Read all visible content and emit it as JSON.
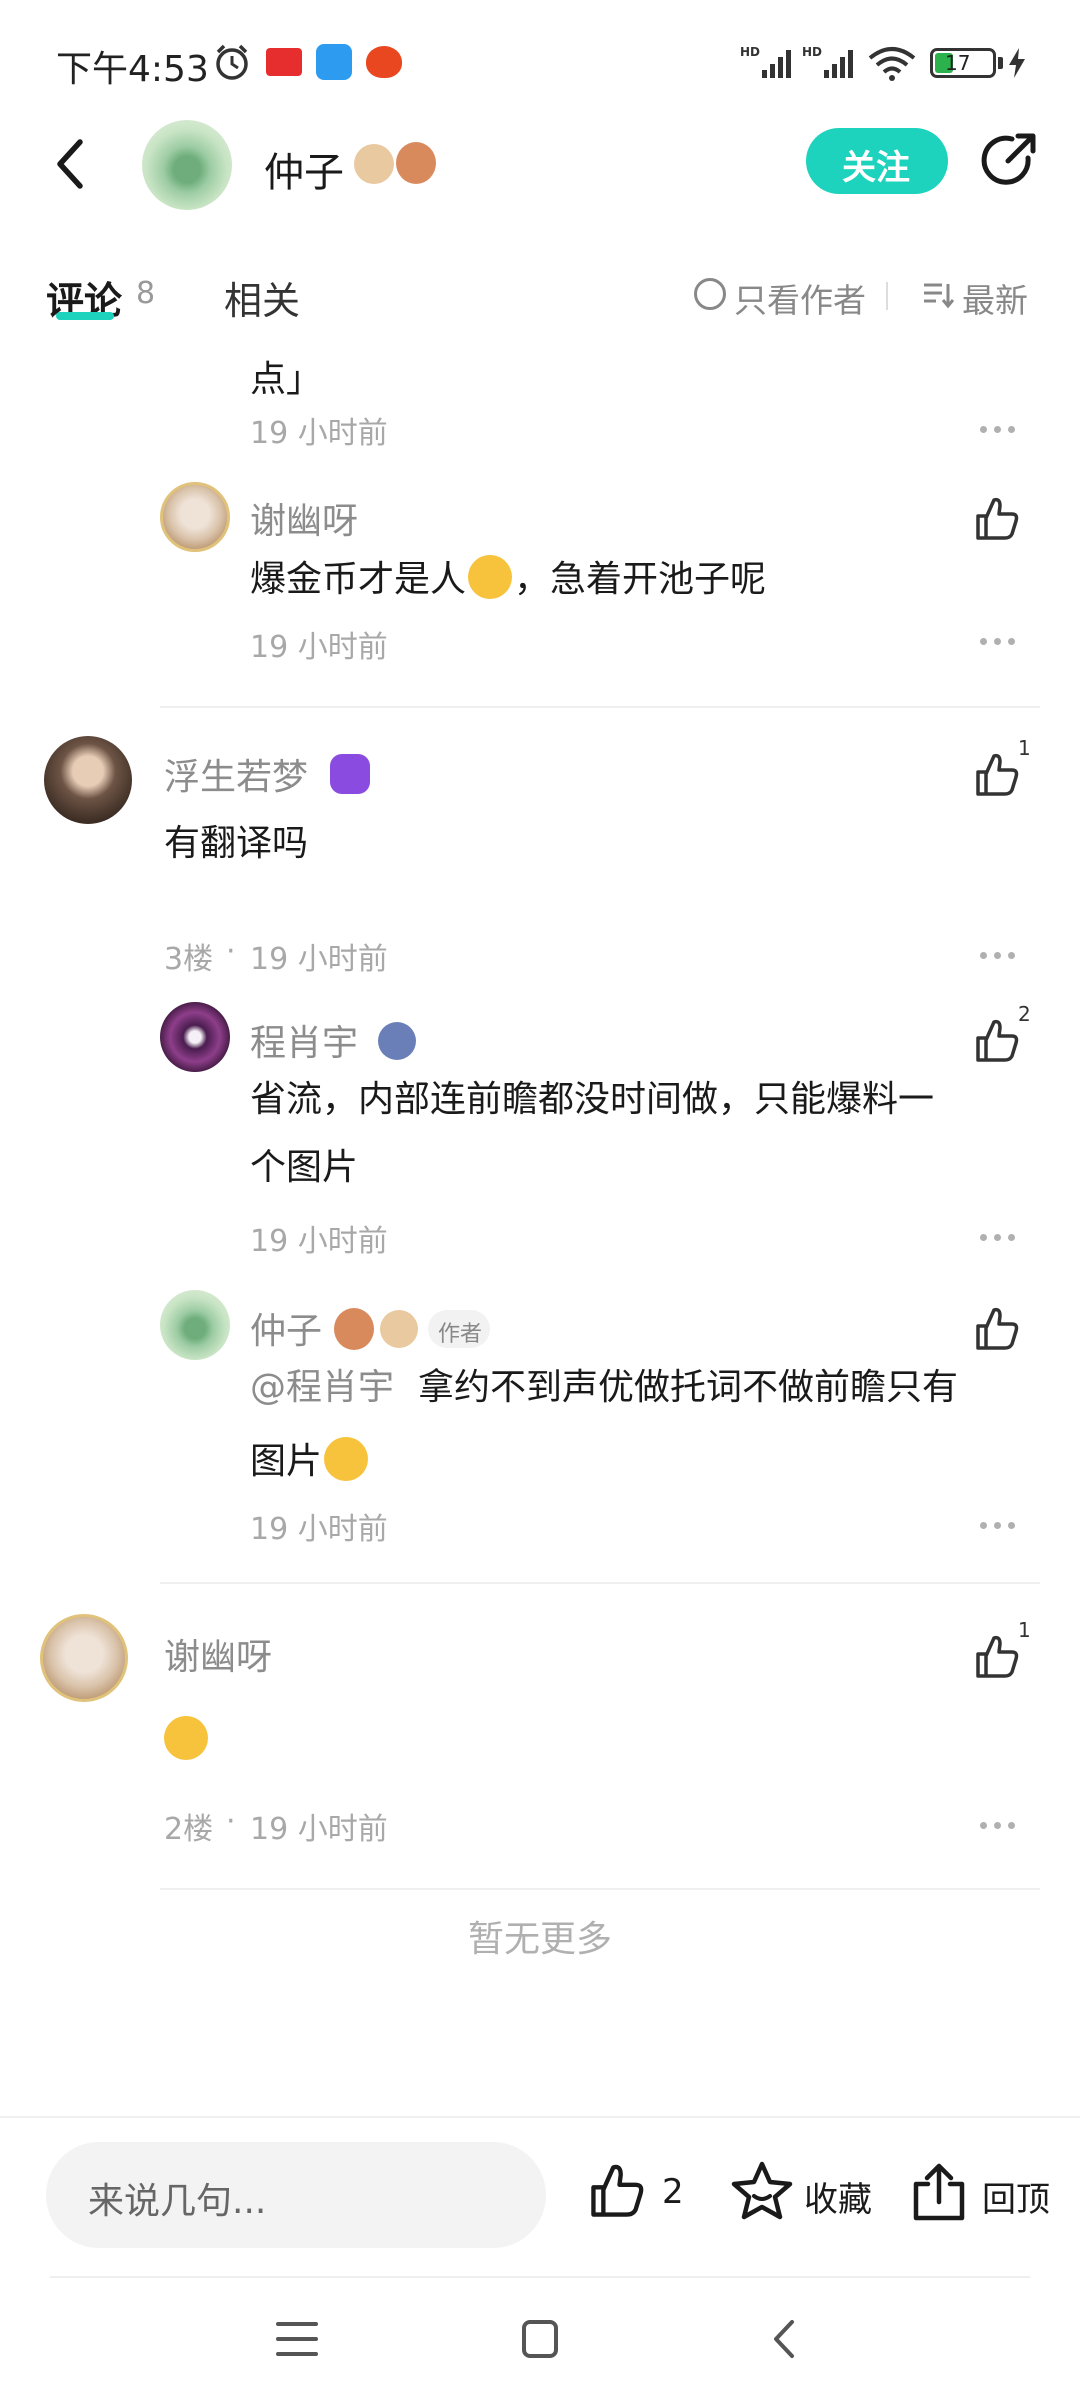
{
  "status_bar": {
    "time": "下午4:53",
    "battery": "17"
  },
  "header": {
    "author_name": "仲子",
    "follow_label": "关注"
  },
  "tabs": {
    "comments_label": "评论",
    "comments_count": "8",
    "related_label": "相关",
    "author_only_label": "只看作者",
    "sort_label": "最新"
  },
  "comments": {
    "partial_text": "点」",
    "partial_time": "19 小时前",
    "reply1": {
      "name": "谢幽呀",
      "text_before": "爆金币才是人",
      "text_after": "，急着开池子呢",
      "time": "19 小时前"
    },
    "c3": {
      "name": "浮生若梦",
      "text": "有翻译吗",
      "floor": "3楼",
      "sep": "·",
      "time": "19 小时前",
      "likes": "1"
    },
    "c3_reply1": {
      "name": "程肖宇",
      "text_line1": "省流，内部连前瞻都没时间做，只能爆料一",
      "text_line2": "个图片",
      "time": "19 小时前",
      "likes": "2"
    },
    "c3_reply2": {
      "name": "仲子",
      "author_tag": "作者",
      "mention": "@程肖宇",
      "text_line1": "拿约不到声优做托词不做前瞻只有",
      "text_line2": "图片",
      "time": "19 小时前"
    },
    "c2": {
      "name": "谢幽呀",
      "floor": "2楼",
      "sep": "·",
      "time": "19 小时前",
      "likes": "1"
    },
    "end_text": "暂无更多"
  },
  "bottom_bar": {
    "input_placeholder": "来说几句...",
    "like_count": "2",
    "collect_label": "收藏",
    "top_label": "回顶"
  },
  "colors": {
    "accent": "#1ed3bd",
    "tab_underline": "#1ed3bd"
  }
}
